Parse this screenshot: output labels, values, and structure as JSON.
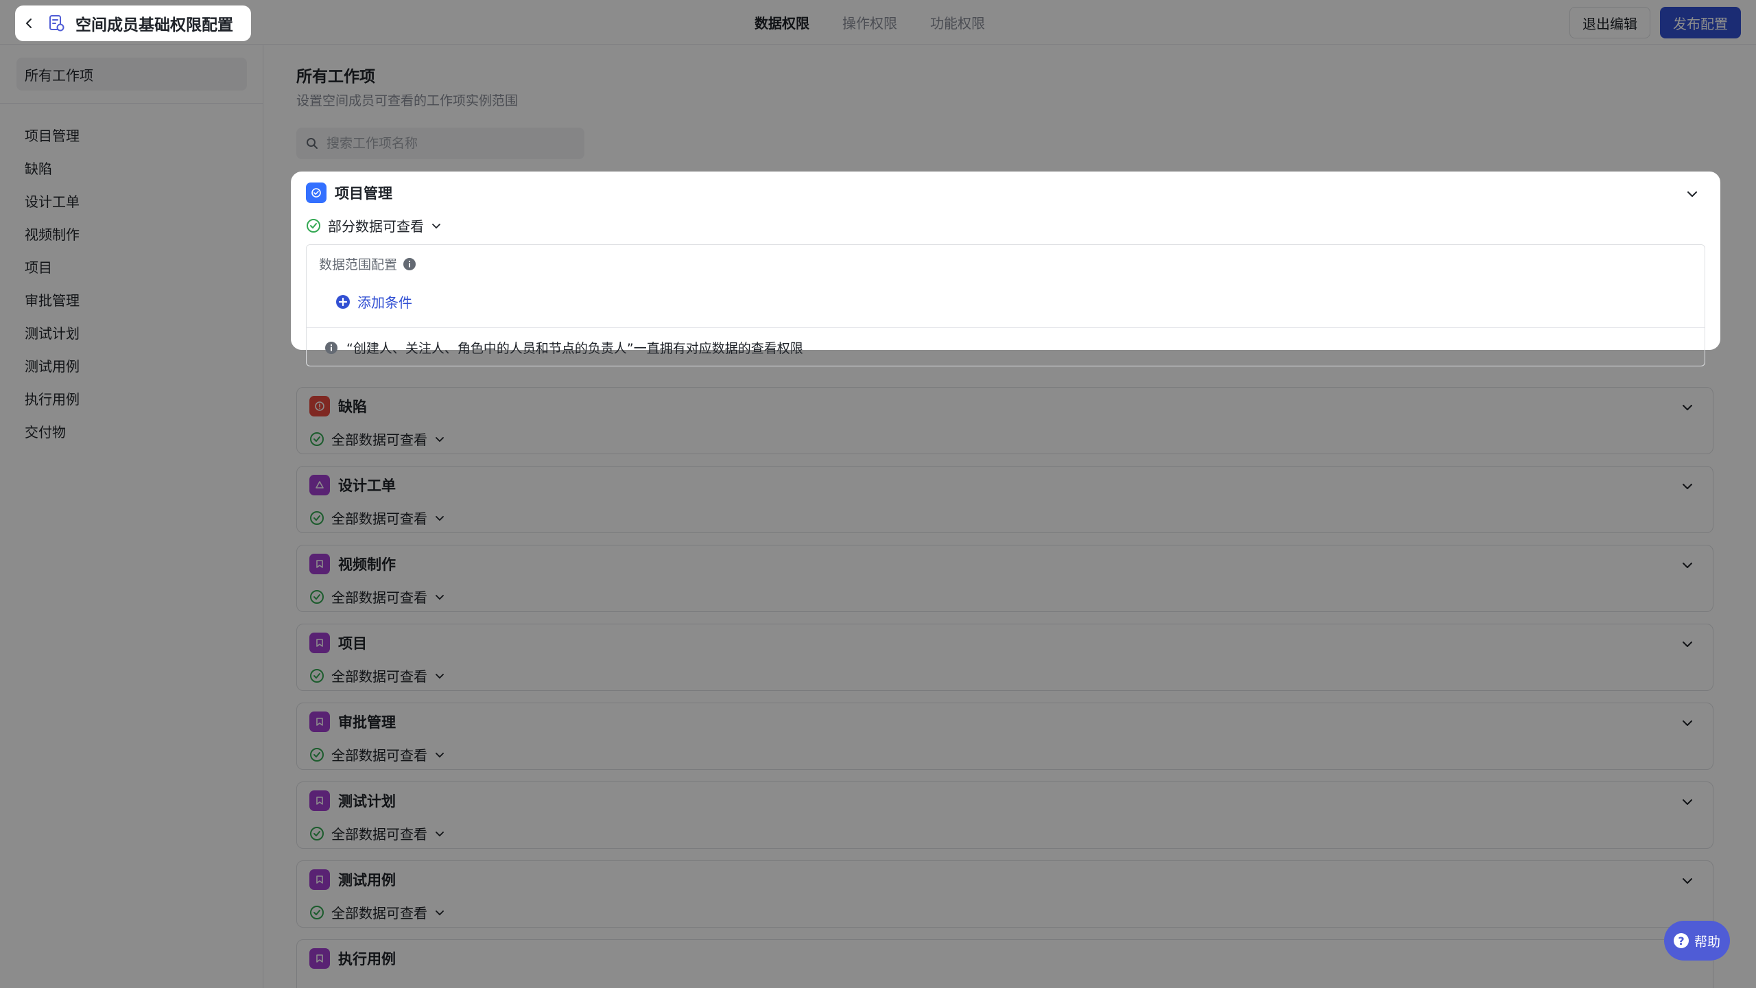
{
  "header": {
    "title": "空间成员基础权限配置",
    "tabs": [
      {
        "label": "数据权限",
        "active": true
      },
      {
        "label": "操作权限",
        "active": false
      },
      {
        "label": "功能权限",
        "active": false
      }
    ],
    "exit_label": "退出编辑",
    "publish_label": "发布配置"
  },
  "sidebar": {
    "all_label": "所有工作项",
    "items": [
      {
        "label": "项目管理"
      },
      {
        "label": "缺陷"
      },
      {
        "label": "设计工单"
      },
      {
        "label": "视频制作"
      },
      {
        "label": "项目"
      },
      {
        "label": "审批管理"
      },
      {
        "label": "测试计划"
      },
      {
        "label": "测试用例"
      },
      {
        "label": "执行用例"
      },
      {
        "label": "交付物"
      }
    ]
  },
  "main": {
    "title": "所有工作项",
    "subtitle": "设置空间成员可查看的工作项实例范围",
    "search_placeholder": "搜索工作项名称",
    "cards": [
      {
        "name": "项目管理",
        "perm": "部分数据可查看",
        "icon_color": "#3370ff",
        "icon": "check-circle-icon",
        "expanded": true
      },
      {
        "name": "缺陷",
        "perm": "全部数据可查看",
        "icon_color": "#e8493f",
        "icon": "alert-icon"
      },
      {
        "name": "设计工单",
        "perm": "全部数据可查看",
        "icon_color": "#a23fd1",
        "icon": "triangle-icon"
      },
      {
        "name": "视频制作",
        "perm": "全部数据可查看",
        "icon_color": "#a23fd1",
        "icon": "bookmark-icon"
      },
      {
        "name": "项目",
        "perm": "全部数据可查看",
        "icon_color": "#a23fd1",
        "icon": "bookmark-icon"
      },
      {
        "name": "审批管理",
        "perm": "全部数据可查看",
        "icon_color": "#a23fd1",
        "icon": "bookmark-icon"
      },
      {
        "name": "测试计划",
        "perm": "全部数据可查看",
        "icon_color": "#a23fd1",
        "icon": "bookmark-icon"
      },
      {
        "name": "测试用例",
        "perm": "全部数据可查看",
        "icon_color": "#a23fd1",
        "icon": "bookmark-icon"
      },
      {
        "name": "执行用例",
        "perm": "",
        "icon_color": "#a23fd1",
        "icon": "bookmark-icon"
      }
    ],
    "scope": {
      "label": "数据范围配置",
      "add_condition": "添加条件",
      "note": "“创建人、关注人、角色中的人员和节点的负责人”一直拥有对应数据的查看权限"
    }
  },
  "help_label": "帮助",
  "colors": {
    "primary": "#3250d3",
    "success": "#34a853"
  }
}
